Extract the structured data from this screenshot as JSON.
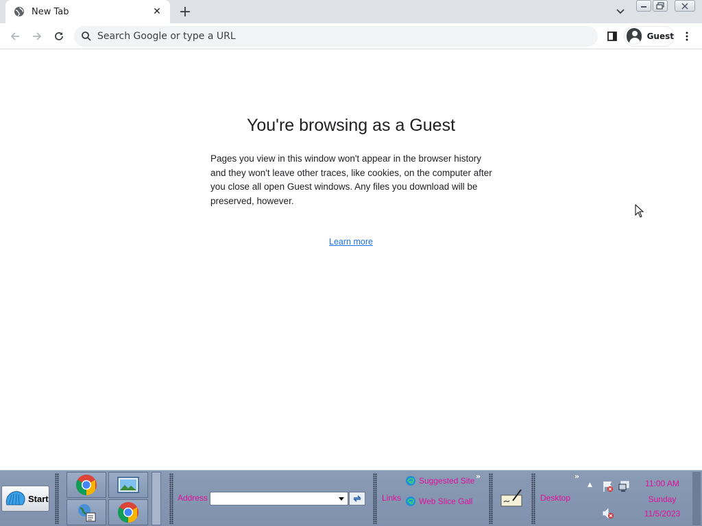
{
  "browser": {
    "tab": {
      "title": "New Tab",
      "close_glyph": "✕"
    },
    "new_tab_glyph": "+",
    "omnibox": {
      "placeholder": "Search Google or type a URL"
    },
    "profile": {
      "label": "Guest"
    }
  },
  "page": {
    "heading": "You're browsing as a Guest",
    "description": "Pages you view in this window won't appear in the browser history and they won't leave other traces, like cookies, on the computer after you close all open Guest windows. Any files you download will be preserved, however.",
    "learn_more": "Learn more",
    "link_color": "#1a73e8"
  },
  "taskbar": {
    "start_label": "Start",
    "address_label": "Address",
    "address_value": "",
    "links_label": "Links",
    "links": [
      {
        "label": "Suggested Site",
        "icon": "edge-icon"
      },
      {
        "label": "Web Slice Gall",
        "icon": "edge-icon"
      }
    ],
    "desktop_label": "Desktop",
    "clock": {
      "time": "11:00 AM",
      "day": "Sunday",
      "date": "11/5/2023"
    },
    "label_color": "#e0109a"
  }
}
